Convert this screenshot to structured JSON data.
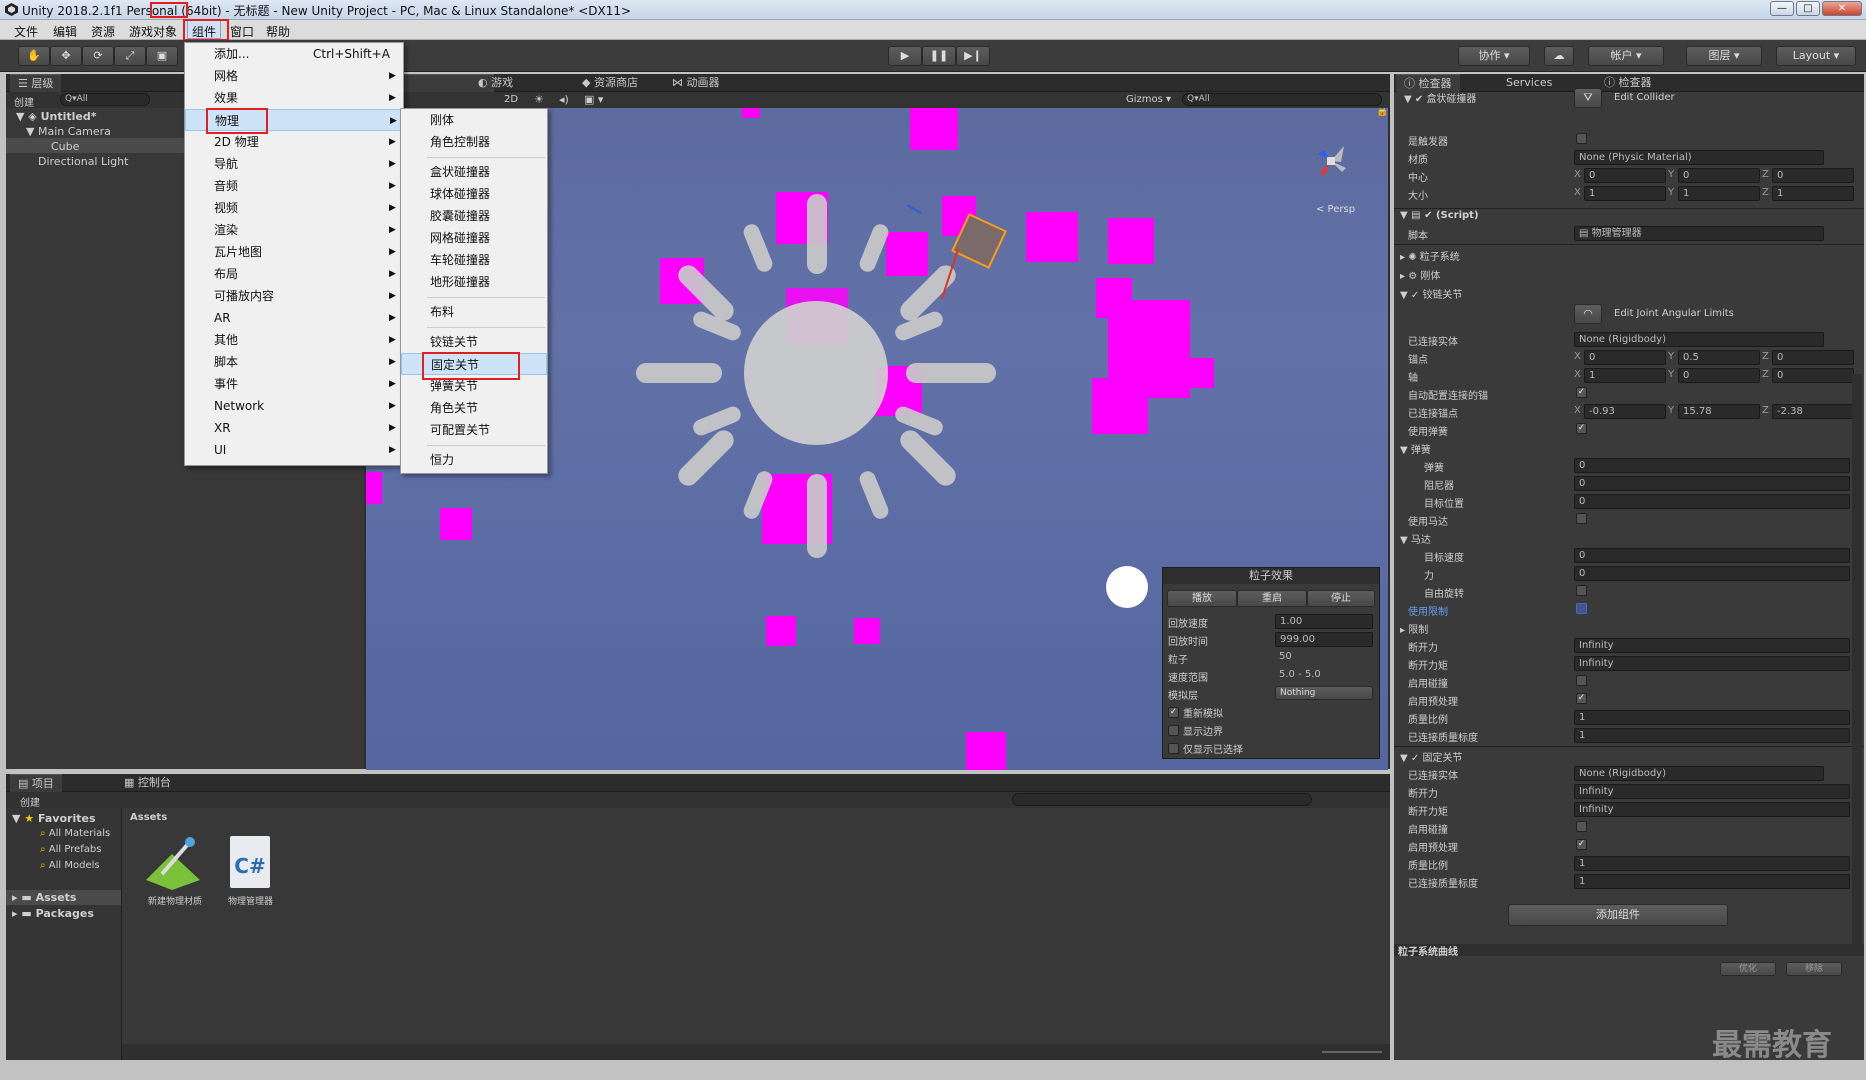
{
  "window": {
    "title": "Unity 2018.2.1f1 Personal (64bit) - 无标题 - New Unity Project - PC, Mac & Linux Standalone* <DX11>",
    "min": "—",
    "max": "□",
    "close": "✕"
  },
  "menubar": [
    "文件",
    "编辑",
    "资源",
    "游戏对象",
    "组件",
    "窗口",
    "帮助"
  ],
  "toolbar": {
    "collab": "协作",
    "account": "帐户",
    "layers": "图层",
    "layout": "Layout"
  },
  "hierarchy": {
    "tab": "层级",
    "create": "创建",
    "search": "Q▾All",
    "scene": "Untitled*",
    "items": [
      "Main Camera",
      "Cube",
      "Directional Light"
    ]
  },
  "scene": {
    "tabs": [
      "游戏",
      "资源商店",
      "动画器"
    ],
    "btn2d": "2D",
    "gizmos": "Gizmos",
    "search": "Q▾All",
    "persp": "< Persp"
  },
  "particle_effect": {
    "title": "粒子效果",
    "buttons": [
      "播放",
      "重启",
      "停止"
    ],
    "rows": [
      {
        "label": "回放速度",
        "value": "1.00"
      },
      {
        "label": "回放时间",
        "value": "999.00"
      },
      {
        "label": "粒子",
        "value": "50"
      },
      {
        "label": "速度范围",
        "value": "5.0 - 5.0"
      },
      {
        "label": "模拟层",
        "value": "Nothing"
      }
    ],
    "checks": [
      "重新模拟",
      "显示边界",
      "仅显示已选择"
    ]
  },
  "component_menu": {
    "items": [
      {
        "label": "添加...",
        "shortcut": "Ctrl+Shift+A"
      },
      {
        "label": "网格"
      },
      {
        "label": "效果"
      },
      {
        "label": "物理"
      },
      {
        "label": "2D 物理"
      },
      {
        "label": "导航"
      },
      {
        "label": "音频"
      },
      {
        "label": "视频"
      },
      {
        "label": "渲染"
      },
      {
        "label": "瓦片地图"
      },
      {
        "label": "布局"
      },
      {
        "label": "可播放内容"
      },
      {
        "label": "AR"
      },
      {
        "label": "其他"
      },
      {
        "label": "脚本"
      },
      {
        "label": "事件"
      },
      {
        "label": "Network"
      },
      {
        "label": "XR"
      },
      {
        "label": "UI"
      }
    ]
  },
  "physics_menu": {
    "items": [
      "刚体",
      "角色控制器",
      "盒状碰撞器",
      "球体碰撞器",
      "胶囊碰撞器",
      "网格碰撞器",
      "车轮碰撞器",
      "地形碰撞器",
      "布料",
      "铰链关节",
      "固定关节",
      "弹簧关节",
      "角色关节",
      "可配置关节",
      "恒力"
    ]
  },
  "project": {
    "tabs": [
      "项目",
      "控制台"
    ],
    "create": "创建",
    "favorites": "Favorites",
    "fav_items": [
      "All Materials",
      "All Prefabs",
      "All Models"
    ],
    "folders": [
      "Assets",
      "Packages"
    ],
    "breadcrumb": "Assets",
    "assets": [
      "新建物理材质",
      "物理管理器"
    ]
  },
  "inspector": {
    "tabs": [
      "检查器",
      "Services",
      "检查器"
    ],
    "box_collider": {
      "title": "盒状碰撞器",
      "edit": "Edit Collider",
      "rows": [
        {
          "label": "是触发器"
        },
        {
          "label": "材质",
          "value": "None (Physic Material)"
        },
        {
          "label": "中心",
          "x": "0",
          "y": "0",
          "z": "0"
        },
        {
          "label": "大小",
          "x": "1",
          "y": "1",
          "z": "1"
        }
      ]
    },
    "script": {
      "title": "(Script)",
      "label": "脚本",
      "value": "物理管理器"
    },
    "components": [
      "粒子系统",
      "刚体",
      "铰链关节"
    ],
    "hinge": {
      "edit": "Edit Joint Angular Limits",
      "connected": {
        "label": "已连接实体",
        "value": "None (Rigidbody)"
      },
      "anchor": {
        "label": "锚点",
        "x": "0",
        "y": "0.5",
        "z": "0"
      },
      "axis": {
        "label": "轴",
        "x": "1",
        "y": "0",
        "z": "0"
      },
      "auto": "自动配置连接的锚",
      "conn_anchor": {
        "label": "已连接锚点",
        "x": "-0.93",
        "y": "15.78",
        "z": "-2.38"
      },
      "use_spring": "使用弹簧",
      "spring_group": "弹簧",
      "spring": {
        "label": "弹簧",
        "value": "0"
      },
      "damper": {
        "label": "阻尼器",
        "value": "0"
      },
      "target_pos": {
        "label": "目标位置",
        "value": "0"
      },
      "use_motor": "使用马达",
      "motor_group": "马达",
      "target_vel": {
        "label": "目标速度",
        "value": "0"
      },
      "force": {
        "label": "力",
        "value": "0"
      },
      "free_spin": "自由旋转",
      "use_limits": "使用限制",
      "limits": "限制",
      "break_force": {
        "label": "断开力",
        "value": "Infinity"
      },
      "break_torque": {
        "label": "断开力矩",
        "value": "Infinity"
      },
      "enable_collision": "启用碰撞",
      "enable_preproc": "启用预处理",
      "mass_scale": {
        "label": "质量比例",
        "value": "1"
      },
      "conn_mass_scale": {
        "label": "已连接质量标度",
        "value": "1"
      }
    },
    "fixed": {
      "title": "固定关节",
      "connected": {
        "label": "已连接实体",
        "value": "None (Rigidbody)"
      },
      "break_force": {
        "label": "断开力",
        "value": "Infinity"
      },
      "break_torque": {
        "label": "断开力矩",
        "value": "Infinity"
      },
      "enable_collision": "启用碰撞",
      "enable_preproc": "启用预处理",
      "mass_scale": {
        "label": "质量比例",
        "value": "1"
      },
      "conn_mass_scale": {
        "label": "已连接质量标度",
        "value": "1"
      }
    },
    "add_component": "添加组件",
    "curves": {
      "title": "粒子系统曲线",
      "optimize": "优化",
      "remove": "移除"
    }
  },
  "watermark": "最需教育"
}
